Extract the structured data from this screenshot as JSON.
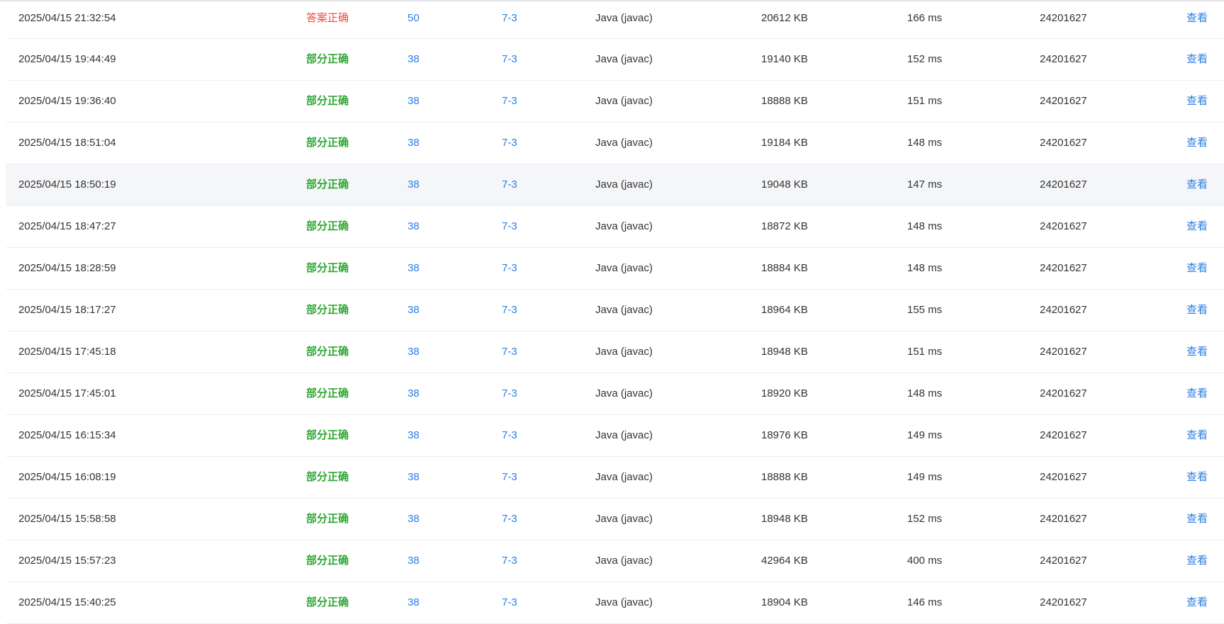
{
  "colors": {
    "accepted": "#f2473e",
    "partial": "#2ea832",
    "link": "#2a7ee6",
    "text": "#333333",
    "row_border": "#ebeef2",
    "row_hover": "#f5f6f8"
  },
  "rows": [
    {
      "time": "2025/04/15 21:32:54",
      "status": "答案正确",
      "status_type": "accepted",
      "score": "50",
      "problem": "7-3",
      "language": "Java (javac)",
      "memory": "20612 KB",
      "runtime": "166 ms",
      "user": "24201627",
      "action": "查看"
    },
    {
      "time": "2025/04/15 19:44:49",
      "status": "部分正确",
      "status_type": "partial",
      "score": "38",
      "problem": "7-3",
      "language": "Java (javac)",
      "memory": "19140 KB",
      "runtime": "152 ms",
      "user": "24201627",
      "action": "查看"
    },
    {
      "time": "2025/04/15 19:36:40",
      "status": "部分正确",
      "status_type": "partial",
      "score": "38",
      "problem": "7-3",
      "language": "Java (javac)",
      "memory": "18888 KB",
      "runtime": "151 ms",
      "user": "24201627",
      "action": "查看"
    },
    {
      "time": "2025/04/15 18:51:04",
      "status": "部分正确",
      "status_type": "partial",
      "score": "38",
      "problem": "7-3",
      "language": "Java (javac)",
      "memory": "19184 KB",
      "runtime": "148 ms",
      "user": "24201627",
      "action": "查看"
    },
    {
      "time": "2025/04/15 18:50:19",
      "status": "部分正确",
      "status_type": "partial",
      "score": "38",
      "problem": "7-3",
      "language": "Java (javac)",
      "memory": "19048 KB",
      "runtime": "147 ms",
      "user": "24201627",
      "action": "查看"
    },
    {
      "time": "2025/04/15 18:47:27",
      "status": "部分正确",
      "status_type": "partial",
      "score": "38",
      "problem": "7-3",
      "language": "Java (javac)",
      "memory": "18872 KB",
      "runtime": "148 ms",
      "user": "24201627",
      "action": "查看"
    },
    {
      "time": "2025/04/15 18:28:59",
      "status": "部分正确",
      "status_type": "partial",
      "score": "38",
      "problem": "7-3",
      "language": "Java (javac)",
      "memory": "18884 KB",
      "runtime": "148 ms",
      "user": "24201627",
      "action": "查看"
    },
    {
      "time": "2025/04/15 18:17:27",
      "status": "部分正确",
      "status_type": "partial",
      "score": "38",
      "problem": "7-3",
      "language": "Java (javac)",
      "memory": "18964 KB",
      "runtime": "155 ms",
      "user": "24201627",
      "action": "查看"
    },
    {
      "time": "2025/04/15 17:45:18",
      "status": "部分正确",
      "status_type": "partial",
      "score": "38",
      "problem": "7-3",
      "language": "Java (javac)",
      "memory": "18948 KB",
      "runtime": "151 ms",
      "user": "24201627",
      "action": "查看"
    },
    {
      "time": "2025/04/15 17:45:01",
      "status": "部分正确",
      "status_type": "partial",
      "score": "38",
      "problem": "7-3",
      "language": "Java (javac)",
      "memory": "18920 KB",
      "runtime": "148 ms",
      "user": "24201627",
      "action": "查看"
    },
    {
      "time": "2025/04/15 16:15:34",
      "status": "部分正确",
      "status_type": "partial",
      "score": "38",
      "problem": "7-3",
      "language": "Java (javac)",
      "memory": "18976 KB",
      "runtime": "149 ms",
      "user": "24201627",
      "action": "查看"
    },
    {
      "time": "2025/04/15 16:08:19",
      "status": "部分正确",
      "status_type": "partial",
      "score": "38",
      "problem": "7-3",
      "language": "Java (javac)",
      "memory": "18888 KB",
      "runtime": "149 ms",
      "user": "24201627",
      "action": "查看"
    },
    {
      "time": "2025/04/15 15:58:58",
      "status": "部分正确",
      "status_type": "partial",
      "score": "38",
      "problem": "7-3",
      "language": "Java (javac)",
      "memory": "18948 KB",
      "runtime": "152 ms",
      "user": "24201627",
      "action": "查看"
    },
    {
      "time": "2025/04/15 15:57:23",
      "status": "部分正确",
      "status_type": "partial",
      "score": "38",
      "problem": "7-3",
      "language": "Java (javac)",
      "memory": "42964 KB",
      "runtime": "400 ms",
      "user": "24201627",
      "action": "查看"
    },
    {
      "time": "2025/04/15 15:40:25",
      "status": "部分正确",
      "status_type": "partial",
      "score": "38",
      "problem": "7-3",
      "language": "Java (javac)",
      "memory": "18904 KB",
      "runtime": "146 ms",
      "user": "24201627",
      "action": "查看"
    }
  ]
}
